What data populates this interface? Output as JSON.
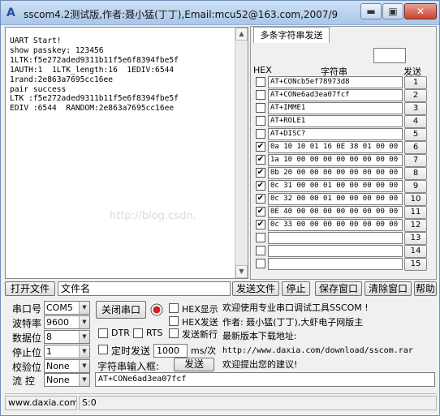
{
  "window": {
    "title": "sscom4.2测试版,作者:聂小猛(丁丁),Email:mcu52@163.com,2007/9",
    "app_icon_glyph": "A",
    "min_glyph": "▬",
    "max_glyph": "▣",
    "close_glyph": "✕"
  },
  "receive": {
    "lines": "UART Start!\nshow passkey: 123456\n1LTK:f5e272aded9311b11f5e6f8394fbe5f\n1AUTH:1  1LTK_length:16  1EDIV:6544\n1rand:2e863a7695cc16ee\npair success\nLTK :f5e272aded9311b11f5e6f8394fbe5f\nEDIV :6544  RANDOM:2e863a7695cc16ee"
  },
  "watermark": "http://blog.csdn.",
  "multi_send": {
    "tab_label": "多条字符串发送",
    "col_hex": "HEX",
    "col_string": "字符串",
    "col_send": "发送",
    "rows": [
      {
        "checked": false,
        "text": "AT+CONcb5ef78973d8",
        "num": "1"
      },
      {
        "checked": false,
        "text": "AT+CONe6ad3ea07fcf",
        "num": "2"
      },
      {
        "checked": false,
        "text": "AT+IMME1",
        "num": "3"
      },
      {
        "checked": false,
        "text": "AT+ROLE1",
        "num": "4"
      },
      {
        "checked": false,
        "text": "AT+DISC?",
        "num": "5"
      },
      {
        "checked": true,
        "text": "0a 10 10 01 16 0E 38 01 00 00 0",
        "num": "6"
      },
      {
        "checked": true,
        "text": "1a 10 00 00 00 00 00 00 00 00 0",
        "num": "7"
      },
      {
        "checked": true,
        "text": "0b 20 00 00 00 00 00 00 00 00 0",
        "num": "8"
      },
      {
        "checked": true,
        "text": "0c 31 00 00 01 00 00 00 00 00 0",
        "num": "9"
      },
      {
        "checked": true,
        "text": "0c 32 00 00 01 00 00 00 00 00 0",
        "num": "10"
      },
      {
        "checked": true,
        "text": "0E 40 00 00 00 00 00 00 00 00 0",
        "num": "11"
      },
      {
        "checked": true,
        "text": "0c 33 00 00 00 00 00 00 00 00 0",
        "num": "12"
      },
      {
        "checked": false,
        "text": "",
        "num": "13"
      },
      {
        "checked": false,
        "text": "",
        "num": "14"
      },
      {
        "checked": false,
        "text": "",
        "num": "15"
      }
    ]
  },
  "file_bar": {
    "open_file": "打开文件",
    "file_name": "文件名",
    "send_file": "发送文件",
    "stop": "停止",
    "save_window": "保存窗口",
    "clear_window": "清除窗口",
    "help": "帮助"
  },
  "settings": {
    "port_label": "串口号",
    "port_value": "COM5",
    "baud_label": "波特率",
    "baud_value": "9600",
    "data_label": "数据位",
    "data_value": "8",
    "stop_label": "停止位",
    "stop_value": "1",
    "parity_label": "校验位",
    "parity_value": "None",
    "flow_label": "流 控",
    "flow_value": "None",
    "close_port": "关闭串口",
    "hex_display": "HEX显示",
    "hex_send": "HEX发送",
    "send_newline": "发送新行",
    "dtr": "DTR",
    "rts": "RTS",
    "timed_send": "定时发送",
    "interval_value": "1000",
    "interval_unit": "ms/次",
    "string_input_label": "字符串输入框:",
    "send_button": "发送",
    "input_value": "AT+CONe6ad3ea07fcf"
  },
  "info_text": [
    "欢迎使用专业串口调试工具SSCOM !",
    "作者: 聂小猛(丁丁),大虾电子网版主",
    "最新版本下载地址:",
    "http://www.daxia.com/download/sscom.rar",
    "欢迎提出您的建议!"
  ],
  "status_bar": {
    "site": "www.daxia.com",
    "s_count": "S:0"
  },
  "colors": {
    "record_indicator": "#d21f1f"
  }
}
